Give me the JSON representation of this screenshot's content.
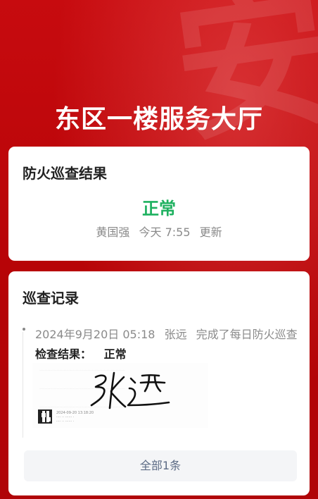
{
  "header": {
    "title": "东区一楼服务大厅",
    "watermark_char": "安"
  },
  "patrol_result": {
    "title": "防火巡查结果",
    "status": "正常",
    "updated_by": "黄国强",
    "updated_time": "今天 7:55",
    "updated_suffix": "更新",
    "status_color": "#1fb160"
  },
  "records": {
    "title": "巡查记录",
    "items": [
      {
        "datetime": "2024年9月20日 05:18",
        "person": "张远",
        "action": "完成了每日防火巡查",
        "result_label": "检查结果：",
        "result_value": "正常",
        "signature_text": "张远",
        "signature_meta_date": "2024-09-20 13:18:20"
      }
    ],
    "all_button_label": "全部1条"
  },
  "colors": {
    "brand_red": "#c8080c",
    "status_green": "#1fb160"
  }
}
